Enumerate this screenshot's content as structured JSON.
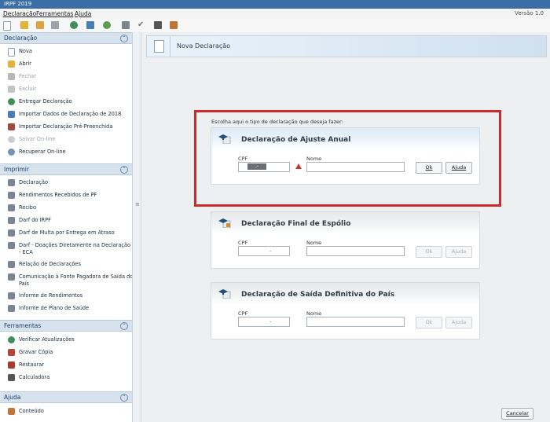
{
  "window": {
    "title": "IRPF 2019",
    "version": "Versão 1.0"
  },
  "menu": [
    "Declaração",
    "Ferramentas",
    "Ajuda"
  ],
  "toolbar": [
    "new-icon",
    "open-icon",
    "folder-icon",
    "trash-icon",
    "globe-icon",
    "import-icon",
    "globe-send-icon",
    "print-icon",
    "check-icon",
    "calculator-icon",
    "book-icon"
  ],
  "sidebar": {
    "declaracao": {
      "title": "Declaração",
      "items": [
        {
          "label": "Nova",
          "icon": "new-doc-icon"
        },
        {
          "label": "Abrir",
          "icon": "open-folder-icon"
        },
        {
          "label": "Fechar",
          "icon": "close-folder-icon"
        },
        {
          "label": "Excluir",
          "icon": "trash-icon"
        },
        {
          "label": "Entregar Declaração",
          "icon": "deliver-icon"
        },
        {
          "label": "Importar Dados de Declaração de 2018",
          "icon": "import-icon"
        },
        {
          "label": "Importar Declaração Pré-Preenchida",
          "icon": "import-prefilled-icon"
        },
        {
          "label": "Salvar On-line",
          "icon": "cloud-save-icon"
        },
        {
          "label": "Recuperar On-line",
          "icon": "cloud-recover-icon"
        }
      ]
    },
    "imprimir": {
      "title": "Imprimir",
      "items": [
        {
          "label": "Declaração",
          "icon": "print-icon"
        },
        {
          "label": "Rendimentos Recebidos de PF",
          "icon": "print-icon"
        },
        {
          "label": "Recibo",
          "icon": "print-icon"
        },
        {
          "label": "Darf do IRPF",
          "icon": "print-icon"
        },
        {
          "label": "Darf de Multa por Entrega em Atraso",
          "icon": "print-icon"
        },
        {
          "label": "Darf - Doações Diretamente na Declaração",
          "label2": "- ECA",
          "icon": "print-icon"
        },
        {
          "label": "Relação de Declarações",
          "icon": "print-icon"
        },
        {
          "label": "Comunicação à Fonte Pagadora de Saída do",
          "label2": "País",
          "icon": "print-icon"
        },
        {
          "label": "Informe de Rendimentos",
          "icon": "print-icon"
        },
        {
          "label": "Informe de Plano de Saúde",
          "icon": "print-icon"
        }
      ]
    },
    "ferramentas": {
      "title": "Ferramentas",
      "items": [
        {
          "label": "Verificar Atualizações",
          "icon": "refresh-icon"
        },
        {
          "label": "Gravar Cópia",
          "icon": "copy-icon"
        },
        {
          "label": "Restaurar",
          "icon": "restore-icon"
        },
        {
          "label": "Calculadora",
          "icon": "calculator-icon"
        }
      ]
    },
    "ajuda": {
      "title": "Ajuda",
      "items": [
        {
          "label": "Conteúdo",
          "icon": "help-icon"
        }
      ]
    }
  },
  "main": {
    "title": "Nova Declaração",
    "prompt": "Escolha aqui o tipo de declaração que deseja fazer:",
    "cpf_label": "CPF",
    "nome_label": "Nome",
    "ok": "Ok",
    "ajuda": "Ajuda",
    "cancelar": "Cancelar",
    "cards": [
      {
        "title": "Declaração de Ajuste Anual",
        "cpf_value": ".-"
      },
      {
        "title": "Declaração Final de Espólio",
        "cpf_value": "-"
      },
      {
        "title": "Declaração de Saída Definitiva do País",
        "cpf_value": "-"
      }
    ]
  },
  "colors": {
    "highlight": "#cc2b2b",
    "section": "#d6e3ef",
    "title_bar": "#3a6ea5"
  }
}
